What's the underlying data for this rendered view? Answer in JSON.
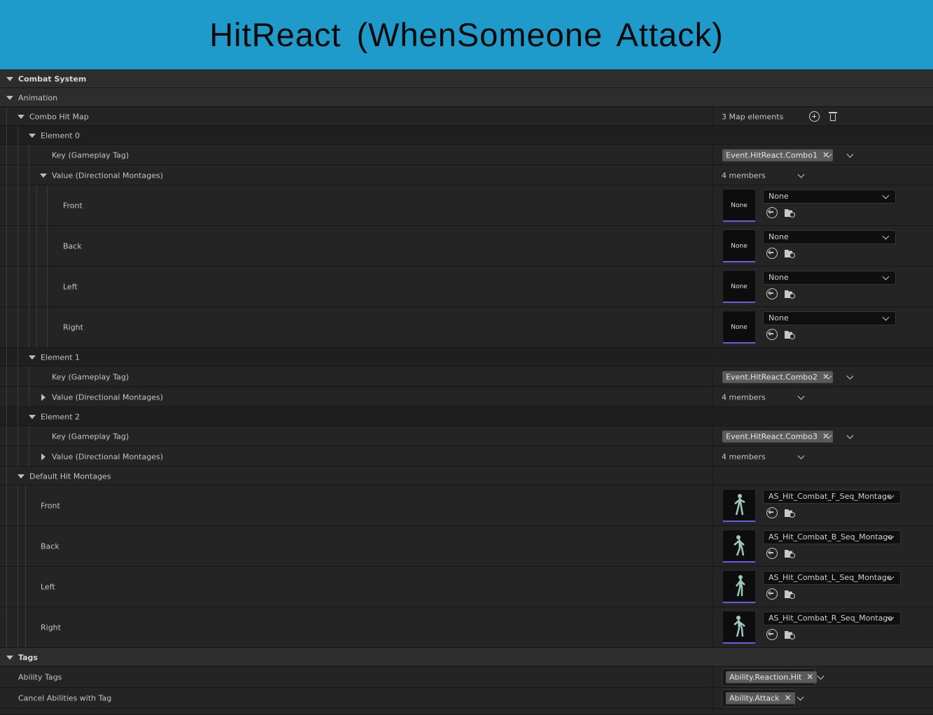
{
  "banner": {
    "title": "HitReact (WhenSomeone Attack)"
  },
  "sections": {
    "combat_system": "Combat System",
    "animation": "Animation",
    "combo_hit_map": "Combo Hit Map",
    "combo_hit_map_count": "3 Map elements",
    "default_hit_montages": "Default Hit Montages",
    "tags": "Tags"
  },
  "elements": [
    {
      "label": "Element 0",
      "key_label": "Key (Gameplay Tag)",
      "key_value": "Event.HitReact.Combo1",
      "value_label": "Value (Directional Montages)",
      "members": "4 members",
      "directions": [
        {
          "label": "Front",
          "thumb": "None",
          "asset": "None"
        },
        {
          "label": "Back",
          "thumb": "None",
          "asset": "None"
        },
        {
          "label": "Left",
          "thumb": "None",
          "asset": "None"
        },
        {
          "label": "Right",
          "thumb": "None",
          "asset": "None"
        }
      ]
    },
    {
      "label": "Element 1",
      "key_label": "Key (Gameplay Tag)",
      "key_value": "Event.HitReact.Combo2",
      "value_label": "Value (Directional Montages)",
      "members": "4 members"
    },
    {
      "label": "Element 2",
      "key_label": "Key (Gameplay Tag)",
      "key_value": "Event.HitReact.Combo3",
      "value_label": "Value (Directional Montages)",
      "members": "4 members"
    }
  ],
  "default_montages": [
    {
      "label": "Front",
      "asset": "AS_Hit_Combat_F_Seq_Montage"
    },
    {
      "label": "Back",
      "asset": "AS_Hit_Combat_B_Seq_Montage"
    },
    {
      "label": "Left",
      "asset": "AS_Hit_Combat_L_Seq_Montage"
    },
    {
      "label": "Right",
      "asset": "AS_Hit_Combat_R_Seq_Montage"
    }
  ],
  "tags": {
    "ability_tags_label": "Ability Tags",
    "ability_tags_value": "Ability.Reaction.Hit",
    "cancel_label": "Cancel Abilities with Tag",
    "cancel_value": "Ability.Attack"
  },
  "colors": {
    "banner": "#1e9acb",
    "thumb_bar": "#6a5ae0"
  }
}
